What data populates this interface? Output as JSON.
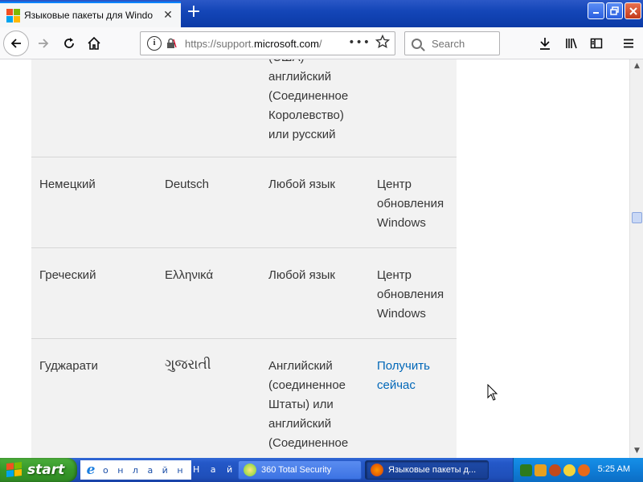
{
  "browser": {
    "tab_title": "Языковые пакеты для Windows",
    "close_tab": "✕",
    "new_tab": "+",
    "url_host": "https://support.",
    "url_domain": "microsoft.com",
    "url_rest": "/",
    "url_dots": "•••",
    "search_placeholder": "Search"
  },
  "table": {
    "rows": [
      {
        "language": "",
        "native": "",
        "base": "(США) английский (Соединенное Королевство) или русский",
        "base_lines": [
          "(США)",
          "английский",
          "(Соединенное",
          "Королевство)",
          "или русский"
        ],
        "action_lines": []
      },
      {
        "language": "Немецкий",
        "native": "Deutsch",
        "base_lines": [
          "Любой язык"
        ],
        "action_lines": [
          "Центр",
          "обновления",
          "Windows"
        ]
      },
      {
        "language": "Греческий",
        "native": "Ελληνικά",
        "base_lines": [
          "Любой язык"
        ],
        "action_lines": [
          "Центр",
          "обновления",
          "Windows"
        ]
      },
      {
        "language": "Гуджарати",
        "native": "ગુજરાતી",
        "base_lines": [
          "Английский",
          "(соединенное",
          "Штаты) или",
          "английский",
          "(Соединенное"
        ],
        "action_link_lines": [
          "Получить",
          "сейчас"
        ]
      }
    ]
  },
  "taskbar": {
    "start_label": "start",
    "quick_ie_text": "о н л а й н - и . . .",
    "quick_find_text": "Н а й т и",
    "tasks": [
      {
        "label": "360 Total Security"
      },
      {
        "label": "Языковые пакеты д..."
      }
    ],
    "clock": "5:25 AM"
  },
  "colors": {
    "link": "#0067b8",
    "table_bg": "#f2f2f2",
    "titlebar": "#1446b8",
    "taskbar": "#2458c8",
    "start": "#379829"
  }
}
